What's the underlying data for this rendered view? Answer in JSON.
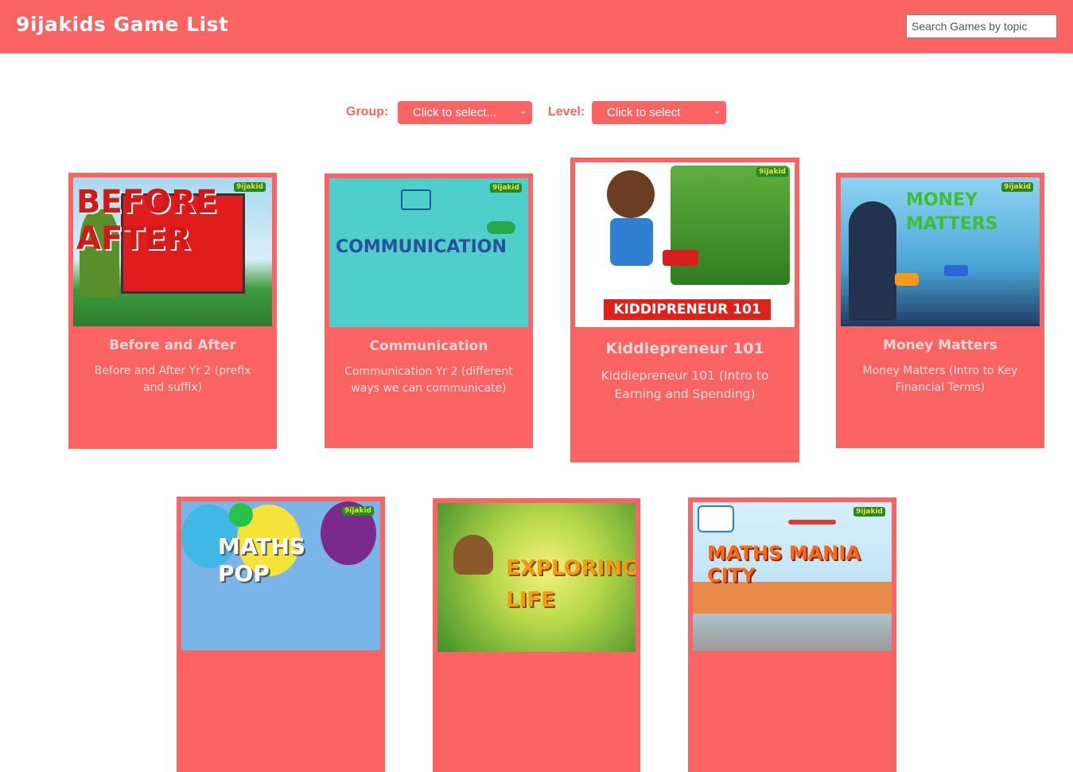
{
  "header": {
    "brand": "9ijakids Game List",
    "search_placeholder": "Search Games by topic"
  },
  "filters": {
    "group_label": "Group:",
    "group_value": "Click to select...",
    "level_label": "Level:",
    "level_value": "Click to select"
  },
  "games": [
    {
      "title": "Before and After",
      "description": "Before and After Yr 2 (prefix and suffix)",
      "art_text": "BEFORE AFTER"
    },
    {
      "title": "Communication",
      "description": "Communication Yr 2 (different ways we can communicate)",
      "art_text": "COMMUNICATION"
    },
    {
      "title": "Kiddiepreneur 101",
      "description": "Kiddiepreneur 101 (Intro to Earning and Spending)",
      "art_text": "KIDDIPRENEUR 101"
    },
    {
      "title": "Money Matters",
      "description": "Money Matters (Intro to Key Financial Terms)",
      "art_text": "MONEY MATTERS"
    },
    {
      "title": "Maths Pop",
      "description": "",
      "art_text": "MATHS POP"
    },
    {
      "title": "Exploring Life",
      "description": "",
      "art_text": "EXPLORING LIFE"
    },
    {
      "title": "Maths Mania City",
      "description": "",
      "art_text": "MATHS MANIA CITY"
    }
  ],
  "badge": "9ijakid",
  "colors": {
    "accent": "#fc6464",
    "white": "#ffffff"
  }
}
